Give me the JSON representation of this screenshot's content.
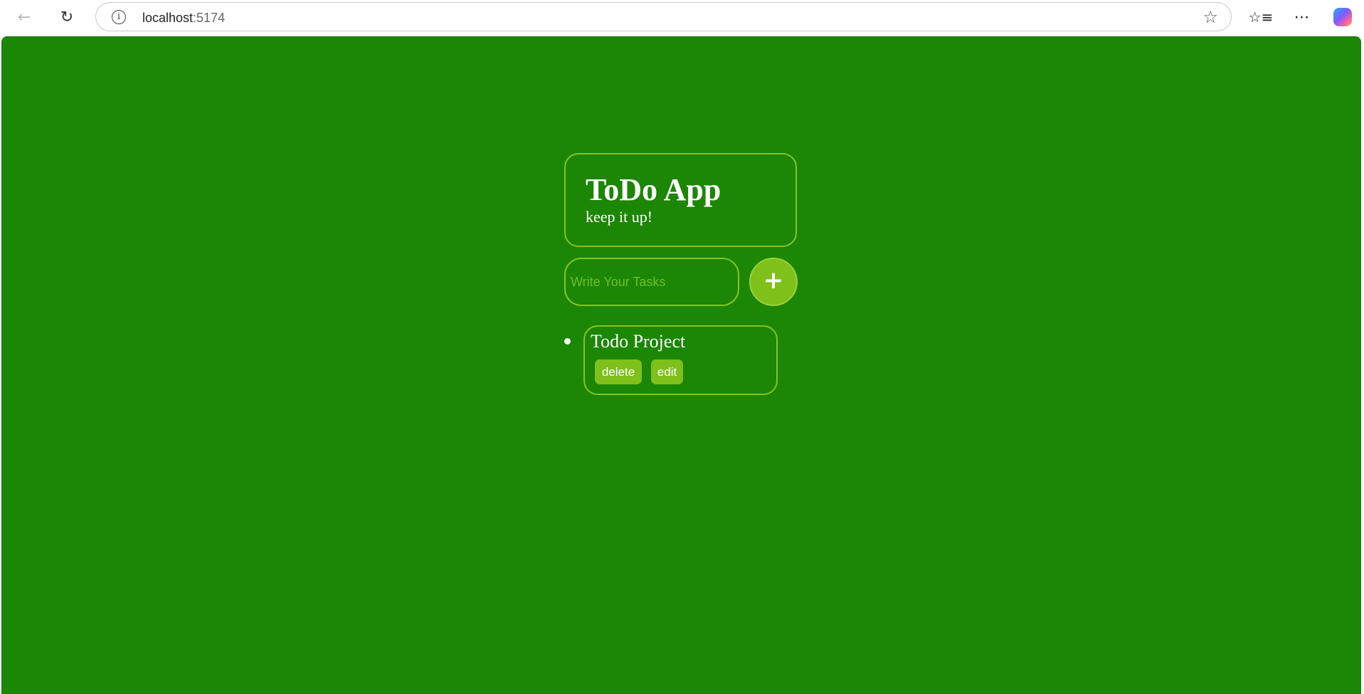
{
  "browser": {
    "url_host": "localhost",
    "url_port": ":5174",
    "icons": {
      "back": "back-arrow-icon",
      "reload": "reload-icon",
      "info": "info-icon",
      "star": "star-icon",
      "favorites": "favorites-icon",
      "more": "more-icon",
      "copilot": "copilot-icon"
    }
  },
  "app": {
    "title": "ToDo App",
    "subtitle": "keep it up!",
    "input_placeholder": "Write Your Tasks",
    "input_value": "",
    "add_label": "+",
    "tasks": [
      {
        "text": "Todo Project",
        "delete_label": "delete",
        "edit_label": "edit"
      }
    ]
  },
  "colors": {
    "background": "#1c8605",
    "accent": "#7fc01a",
    "border": "#86c41e",
    "text": "#ffffff"
  }
}
